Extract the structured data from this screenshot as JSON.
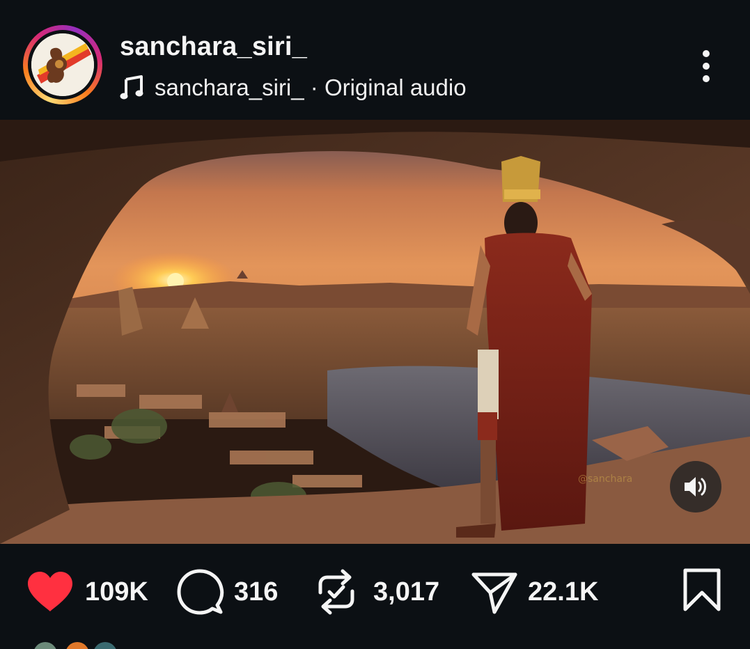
{
  "post": {
    "username": "sanchara_siri_",
    "audio_text": "sanchara_siri_ · Original audio"
  },
  "icons": {
    "music": "music-note-icon",
    "more": "more-vertical-icon",
    "mute": "speaker-volume-icon",
    "like": "heart-icon",
    "comment": "comment-bubble-icon",
    "repost": "repost-icon",
    "share": "send-icon",
    "save": "bookmark-icon"
  },
  "actions": {
    "likes": "109K",
    "comments": "316",
    "reposts": "3,017",
    "shares": "22.1K"
  },
  "colors": {
    "background": "#0c1014",
    "like_red": "#ff3040",
    "text": "#f5f5f5"
  }
}
